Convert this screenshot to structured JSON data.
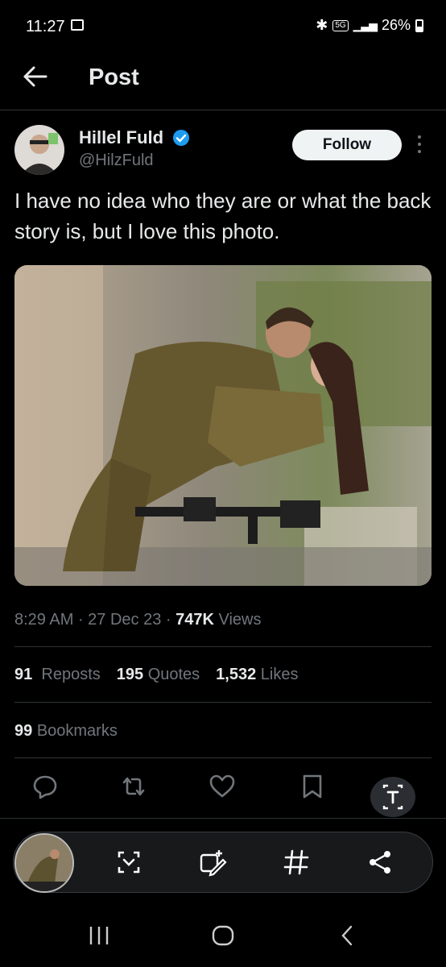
{
  "status_bar": {
    "time": "11:27",
    "network": "5G",
    "battery": "26%"
  },
  "header": {
    "title": "Post"
  },
  "author": {
    "name": "Hillel Fuld",
    "handle": "@HilzFuld"
  },
  "follow_label": "Follow",
  "tweet_text": "I have no idea who they are or what the back story is, but I love this photo.",
  "meta": {
    "time": "8:29 AM",
    "date": "27 Dec 23",
    "views_count": "747K",
    "views_label": "Views"
  },
  "stats": {
    "reposts_count": "91",
    "reposts_label": "Reposts",
    "quotes_count": "195",
    "quotes_label": "Quotes",
    "likes_count": "1,532",
    "likes_label": "Likes",
    "bookmarks_count": "99",
    "bookmarks_label": "Bookmarks"
  },
  "colors": {
    "verified": "#1d9bf0",
    "background": "#000000",
    "muted_text": "#71767b",
    "divider": "#2f3336"
  },
  "icons": [
    "arrow-left-icon",
    "verified-icon",
    "more-vertical-icon",
    "reply-icon",
    "repost-icon",
    "like-icon",
    "bookmark-icon",
    "text-scan-icon",
    "scan-icon",
    "edit-icon",
    "hashtag-icon",
    "share-icon",
    "recents-icon",
    "home-icon",
    "back-icon"
  ]
}
